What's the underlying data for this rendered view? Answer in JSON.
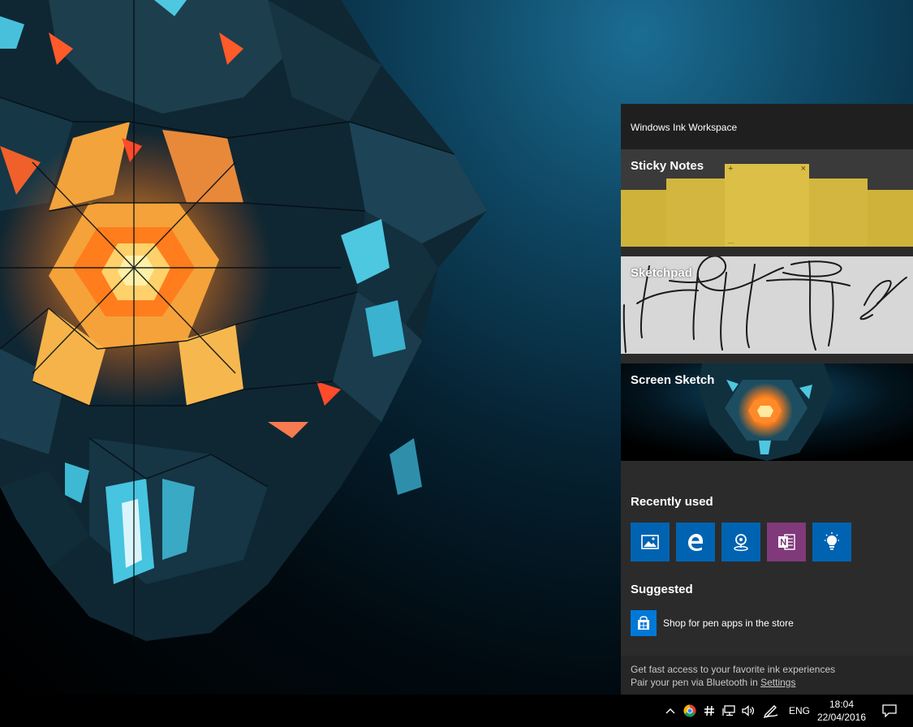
{
  "workspace": {
    "title": "Windows Ink Workspace",
    "tiles": {
      "sticky_notes": "Sticky Notes",
      "sticky_plus": "+",
      "sticky_close": "×",
      "sticky_more": "...",
      "sketchpad": "Sketchpad",
      "screen_sketch": "Screen Sketch"
    },
    "recently_used": {
      "title": "Recently used",
      "apps": [
        "photos-icon",
        "edge-icon",
        "maps-icon",
        "onenote-icon",
        "tips-icon"
      ]
    },
    "suggested": {
      "title": "Suggested",
      "item": "Shop for pen apps in the store"
    },
    "footer": {
      "line1": "Get fast access to your favorite ink experiences",
      "line2_prefix": "Pair your pen via Bluetooth in ",
      "line2_link": "Settings"
    }
  },
  "taskbar": {
    "language": "ENG",
    "time": "18:04",
    "date": "22/04/2016",
    "tray_icons": [
      "chevron-up-icon",
      "chrome-icon",
      "hashtag-icon",
      "network-icon",
      "volume-icon",
      "pen-icon",
      "action-center-icon"
    ]
  },
  "colors": {
    "accent": "#0063b1",
    "onenote": "#80397b",
    "sticky_yellow": "#cfb23a",
    "panel_bg": "#2b2b2b"
  }
}
